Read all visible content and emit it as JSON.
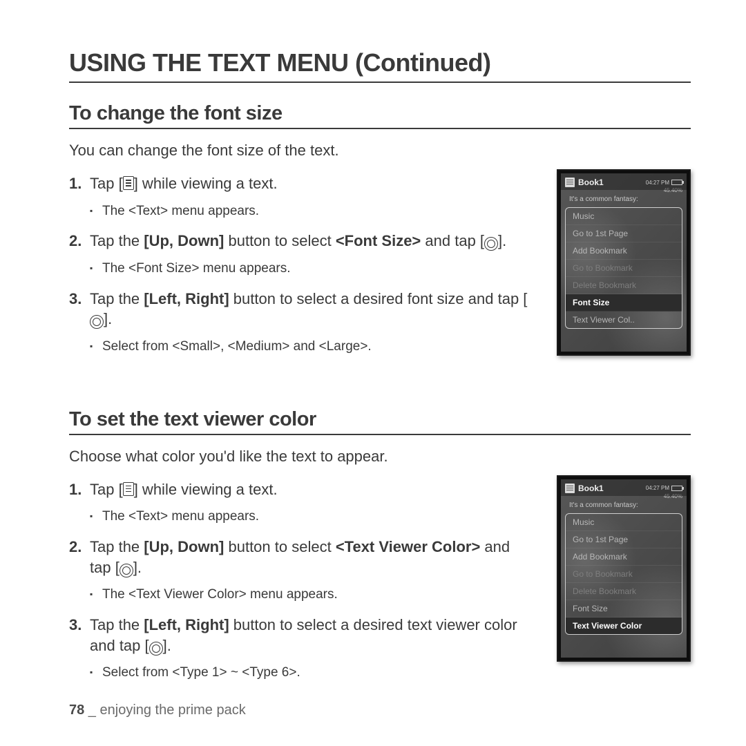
{
  "page": {
    "title": "USING THE TEXT MENU (Continued)",
    "footer_page": "78",
    "footer_sep": " _ ",
    "footer_section": "enjoying the prime pack"
  },
  "section1": {
    "heading": "To change the font size",
    "intro": "You can change the font size of the text.",
    "step1": "Tap [",
    "step1b": "] while viewing a text.",
    "step1_sub": "The <Text> menu appears.",
    "step2a": "Tap the ",
    "step2_btn": "[Up, Down]",
    "step2b": " button to select ",
    "step2_sel": "<Font Size>",
    "step2c": " and tap [",
    "step2d": "].",
    "step2_sub": "The <Font Size> menu appears.",
    "step3a": "Tap the ",
    "step3_btn": "[Left, Right]",
    "step3b": " button to select a desired font size and tap [",
    "step3c": "].",
    "step3_sub": "Select from <Small>, <Medium> and <Large>."
  },
  "section2": {
    "heading": "To set the text viewer color",
    "intro": "Choose what color you'd like the text to appear.",
    "step1": "Tap [",
    "step1b": "] while viewing a text.",
    "step1_sub": "The <Text> menu appears.",
    "step2a": "Tap the ",
    "step2_btn": "[Up, Down]",
    "step2b": " button to select ",
    "step2_sel": "<Text Viewer Color>",
    "step2c": " and tap [",
    "step2d": "].",
    "step2_sub": "The <Text Viewer Color> menu appears.",
    "step3a": "Tap the ",
    "step3_btn": "[Left, Right]",
    "step3b": " button to select a desired text viewer color and tap [",
    "step3c": "].",
    "step3_sub": "Select from <Type 1> ~ <Type 6>."
  },
  "device": {
    "book": "Book1",
    "time": "04:27 PM",
    "pct": "45.40%",
    "fantasy": "It's a common fantasy:",
    "items": [
      "Music",
      "Go to 1st Page",
      "Add Bookmark",
      "Go to Bookmark",
      "Delete Bookmark",
      "Font Size",
      "Text Viewer Col.."
    ],
    "items2": [
      "Music",
      "Go to 1st Page",
      "Add Bookmark",
      "Go to Bookmark",
      "Delete Bookmark",
      "Font Size",
      "Text Viewer Color"
    ]
  }
}
